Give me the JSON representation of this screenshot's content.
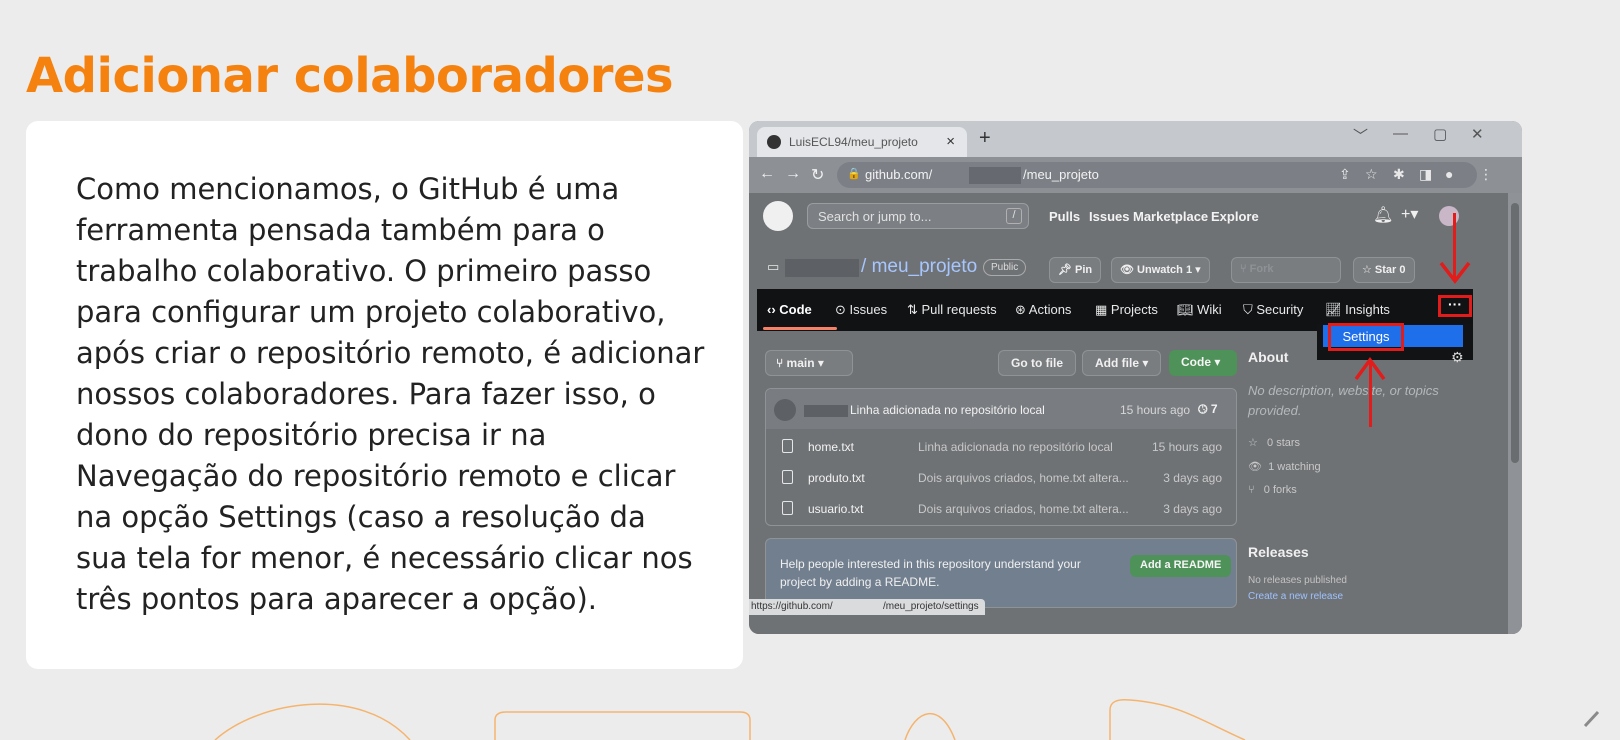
{
  "slide": {
    "title": "Adicionar colaboradores",
    "body": "Como mencionamos, o GitHub é uma ferramenta pensada também para o trabalho colaborativo. O primeiro passo para configurar um projeto colaborativo, após criar o repositório remoto, é adicionar nossos colaboradores. Para fazer isso, o dono do repositório precisa ir na Navegação do repositório remoto e clicar na opção Settings (caso a resolução da sua tela for menor, é necessário clicar nos três pontos para aparecer a opção)."
  },
  "browser": {
    "tab_title": "LuisECL94/meu_projeto",
    "tab_close": "×",
    "new_tab": "+",
    "win_controls": [
      "﹀",
      "—",
      "▢",
      "✕"
    ],
    "url_host": "github.com/",
    "url_path": "/meu_projeto",
    "status_url_start": "https://github.com/",
    "status_url_end": "/meu_projeto/settings"
  },
  "github": {
    "search_placeholder": "Search or jump to...",
    "search_key": "/",
    "top_nav": [
      "Pulls",
      "Issues",
      "Marketplace",
      "Explore"
    ],
    "repo_name": "meu_projeto",
    "repo_sep": "/",
    "visibility": "Public",
    "actions": {
      "pin": "Pin",
      "unwatch": "Unwatch",
      "unwatch_count": "1",
      "fork": "Fork",
      "star": "Star",
      "star_count": "0"
    },
    "repo_nav": [
      "Code",
      "Issues",
      "Pull requests",
      "Actions",
      "Projects",
      "Wiki",
      "Security",
      "Insights"
    ],
    "more_label": "···",
    "settings_label": "Settings",
    "branch": "main",
    "go_to_file": "Go to file",
    "add_file": "Add file",
    "code_btn": "Code",
    "commit": {
      "message": "Linha adicionada no repositório local",
      "time": "15 hours ago",
      "count": "7"
    },
    "files": [
      {
        "name": "home.txt",
        "message": "Linha adicionada no repositório local",
        "time": "15 hours ago"
      },
      {
        "name": "produto.txt",
        "message": "Dois arquivos criados, home.txt altera...",
        "time": "3 days ago"
      },
      {
        "name": "usuario.txt",
        "message": "Dois arquivos criados, home.txt altera...",
        "time": "3 days ago"
      }
    ],
    "readme_prompt": "Help people interested in this repository understand your project by adding a README.",
    "add_readme": "Add a README",
    "about": {
      "title": "About",
      "description": "No description, website, or topics provided.",
      "stars": "0 stars",
      "watching": "1 watching",
      "forks": "0 forks"
    },
    "releases": {
      "title": "Releases",
      "none": "No releases published",
      "create": "Create a new release"
    }
  },
  "colors": {
    "title_orange": "#f5820f",
    "highlight_red": "#e21b1b",
    "settings_blue": "#1f6feb"
  }
}
